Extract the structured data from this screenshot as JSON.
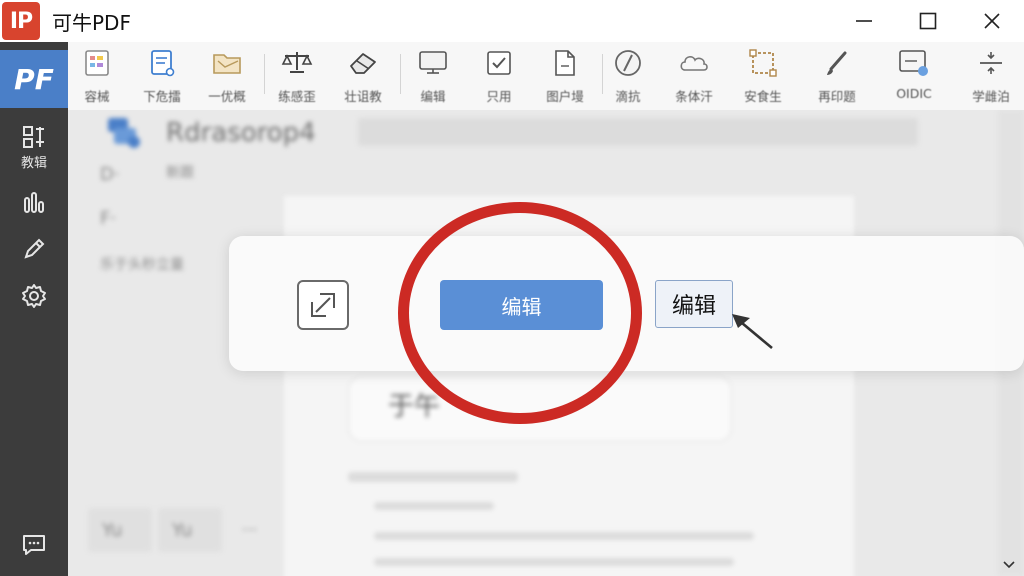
{
  "window": {
    "logo_text": "IP",
    "title": "可牛PDF"
  },
  "sidebar": {
    "brand": "PF",
    "items": [
      {
        "icon": "edit-layout-icon",
        "label": "教辑"
      },
      {
        "icon": "chart-icon",
        "label": ""
      },
      {
        "icon": "pen-icon",
        "label": ""
      },
      {
        "icon": "gear-icon",
        "label": ""
      }
    ],
    "bottom_icon": "chat-icon"
  },
  "toolbar": {
    "items": [
      {
        "icon": "template-icon",
        "label": "容械"
      },
      {
        "icon": "document-edit-icon",
        "label": "下危擂"
      },
      {
        "icon": "folder-icon",
        "label": "一优概"
      },
      {
        "icon": "scale-icon",
        "label": "练感歪"
      },
      {
        "icon": "eraser-icon",
        "label": "壮诅教"
      },
      {
        "icon": "monitor-icon",
        "label": "编辑"
      },
      {
        "icon": "checkbox-icon",
        "label": "只用"
      },
      {
        "icon": "page-icon",
        "label": "图户墁"
      },
      {
        "icon": "compass-icon",
        "label": "滴抗"
      },
      {
        "icon": "cloud-icon",
        "label": "条体汗"
      },
      {
        "icon": "crop-icon",
        "label": "安食生"
      },
      {
        "icon": "brush-icon",
        "label": "再印题"
      },
      {
        "icon": "ocr-icon",
        "label": "OIDIC"
      },
      {
        "icon": "split-icon",
        "label": "学雌泊"
      }
    ]
  },
  "document": {
    "heading": "Rdrasorop4",
    "ghost_texts": [
      "D·",
      "F·",
      "新跟",
      "乐于头秒立量",
      "于午",
      "Yu",
      "Yu",
      "···"
    ]
  },
  "dialog": {
    "primary_button": "编辑",
    "secondary_button": "编辑"
  },
  "colors": {
    "accent": "#5a8fd6",
    "brand_red": "#d8442e",
    "sidebar_bg": "#3c3c3c",
    "highlight_ring": "#cc2a24"
  }
}
